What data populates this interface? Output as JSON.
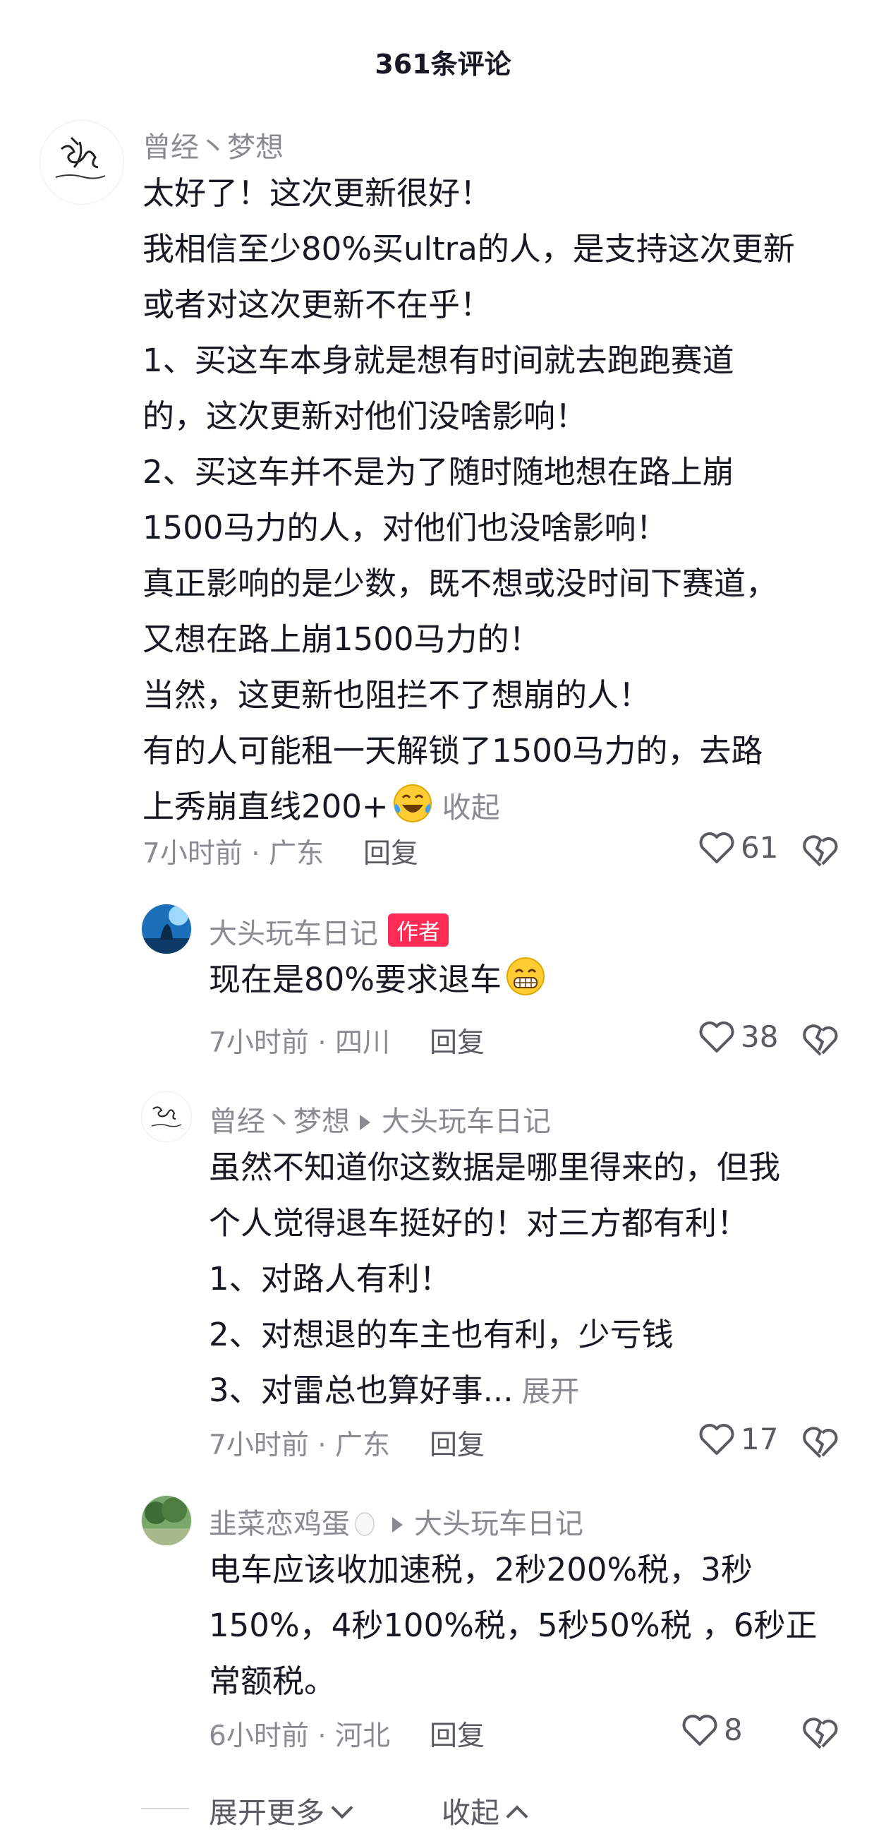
{
  "header": {
    "title": "361条评论"
  },
  "comments": [
    {
      "author": "曾经丶梦想",
      "lines": [
        "太好了！这次更新很好！",
        "我相信至少80%买ultra的人，是支持这次更新",
        "或者对这次更新不在乎！",
        "1、买这车本身就是想有时间就去跑跑赛道",
        "的，这次更新对他们没啥影响！",
        "2、买这车并不是为了随时随地想在路上崩",
        "1500马力的人，对他们也没啥影响！",
        "真正影响的是少数，既不想或没时间下赛道，",
        "又想在路上崩1500马力的！",
        "当然，这更新也阻拦不了想崩的人！",
        "有的人可能租一天解锁了1500马力的，去路",
        "上秀崩直线200+"
      ],
      "emoji": "laughing-tears-icon",
      "collapse_label": "收起",
      "time": "7小时前",
      "location": "广东",
      "reply_label": "回复",
      "likes": "61"
    }
  ],
  "replies": [
    {
      "author": "大头玩车日记",
      "author_badge": "作者",
      "text": "现在是80%要求退车",
      "emoji": "grinning-icon",
      "time": "7小时前",
      "location": "四川",
      "reply_label": "回复",
      "likes": "38"
    },
    {
      "author": "曾经丶梦想",
      "reply_to": "大头玩车日记",
      "lines": [
        "虽然不知道你这数据是哪里得来的，但我",
        "个人觉得退车挺好的！对三方都有利！",
        "1、对路人有利！",
        "2、对想退的车主也有利，少亏钱",
        "3、对雷总也算好事..."
      ],
      "expand_label": "展开",
      "time": "7小时前",
      "location": "广东",
      "reply_label": "回复",
      "likes": "17"
    },
    {
      "author": "韭菜恋鸡蛋",
      "author_emoji": "egg-icon",
      "reply_to": "大头玩车日记",
      "lines": [
        "电车应该收加速税，2秒200%税，3秒",
        "150%，4秒100%税，5秒50%税 ，6秒正",
        "常额税。"
      ],
      "time": "6小时前",
      "location": "河北",
      "reply_label": "回复",
      "likes": "8"
    }
  ],
  "footer": {
    "expand_more_label": "展开更多",
    "collapse_label": "收起"
  },
  "colors": {
    "badge": "#fe2c55",
    "text": "#161823",
    "meta": "#8a8b91"
  }
}
